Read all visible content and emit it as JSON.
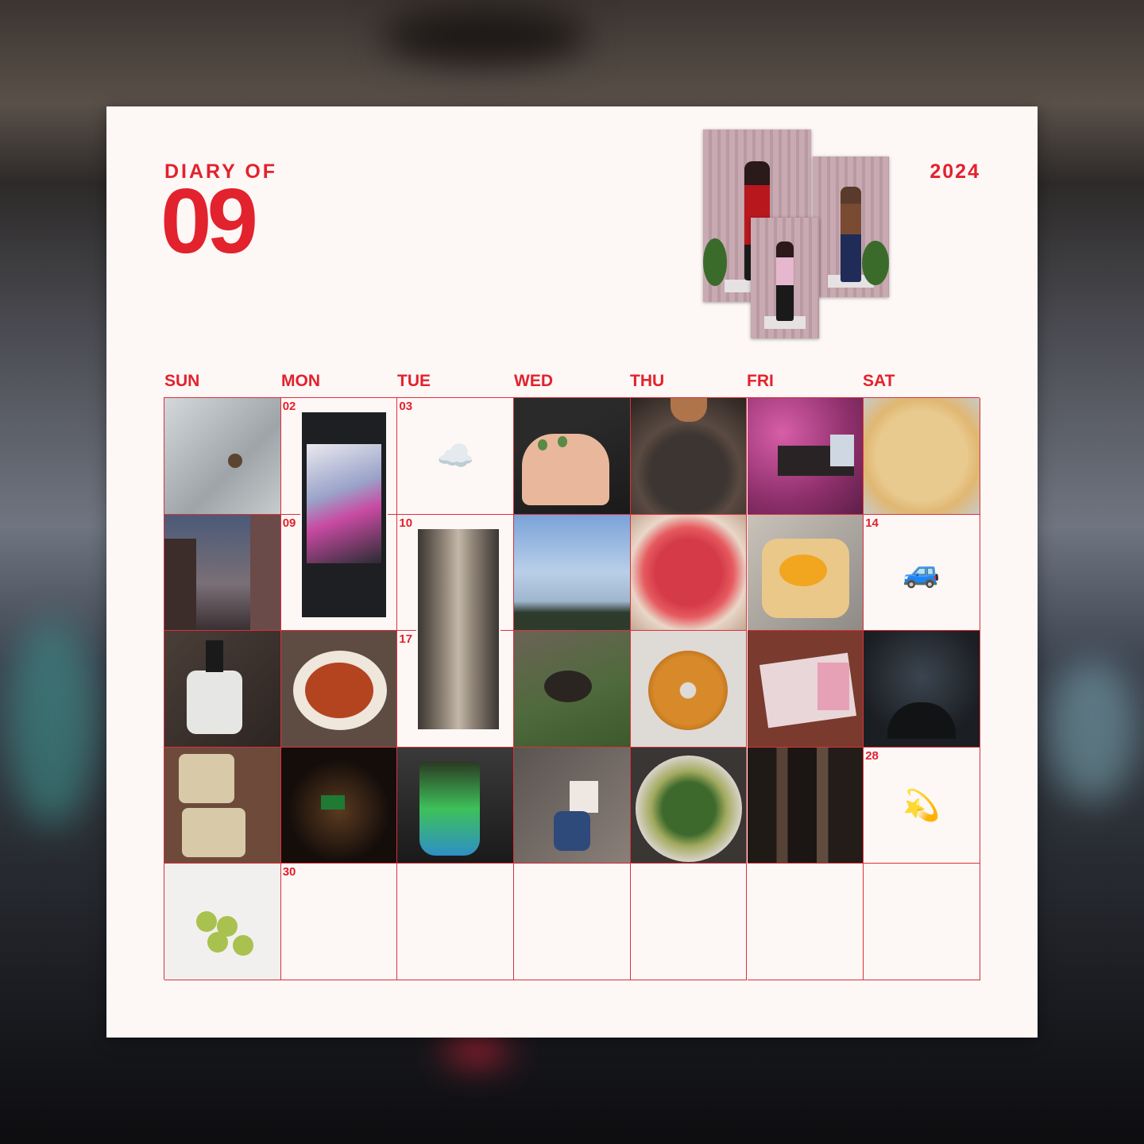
{
  "header": {
    "diary_label": "DIARY OF",
    "month_number": "09",
    "year": "2024"
  },
  "weekdays": [
    "SUN",
    "MON",
    "TUE",
    "WED",
    "THU",
    "FRI",
    "SAT"
  ],
  "day_labels": {
    "d02": "02",
    "d03": "03",
    "d09": "09",
    "d10": "10",
    "d14": "14",
    "d17": "17",
    "d28": "28",
    "d30": "30"
  },
  "emojis": {
    "cloud": "☁️",
    "car": "🚙",
    "dizzy": "💫"
  },
  "colors": {
    "accent_red": "#e2222d",
    "paper": "#fdf7f6"
  }
}
